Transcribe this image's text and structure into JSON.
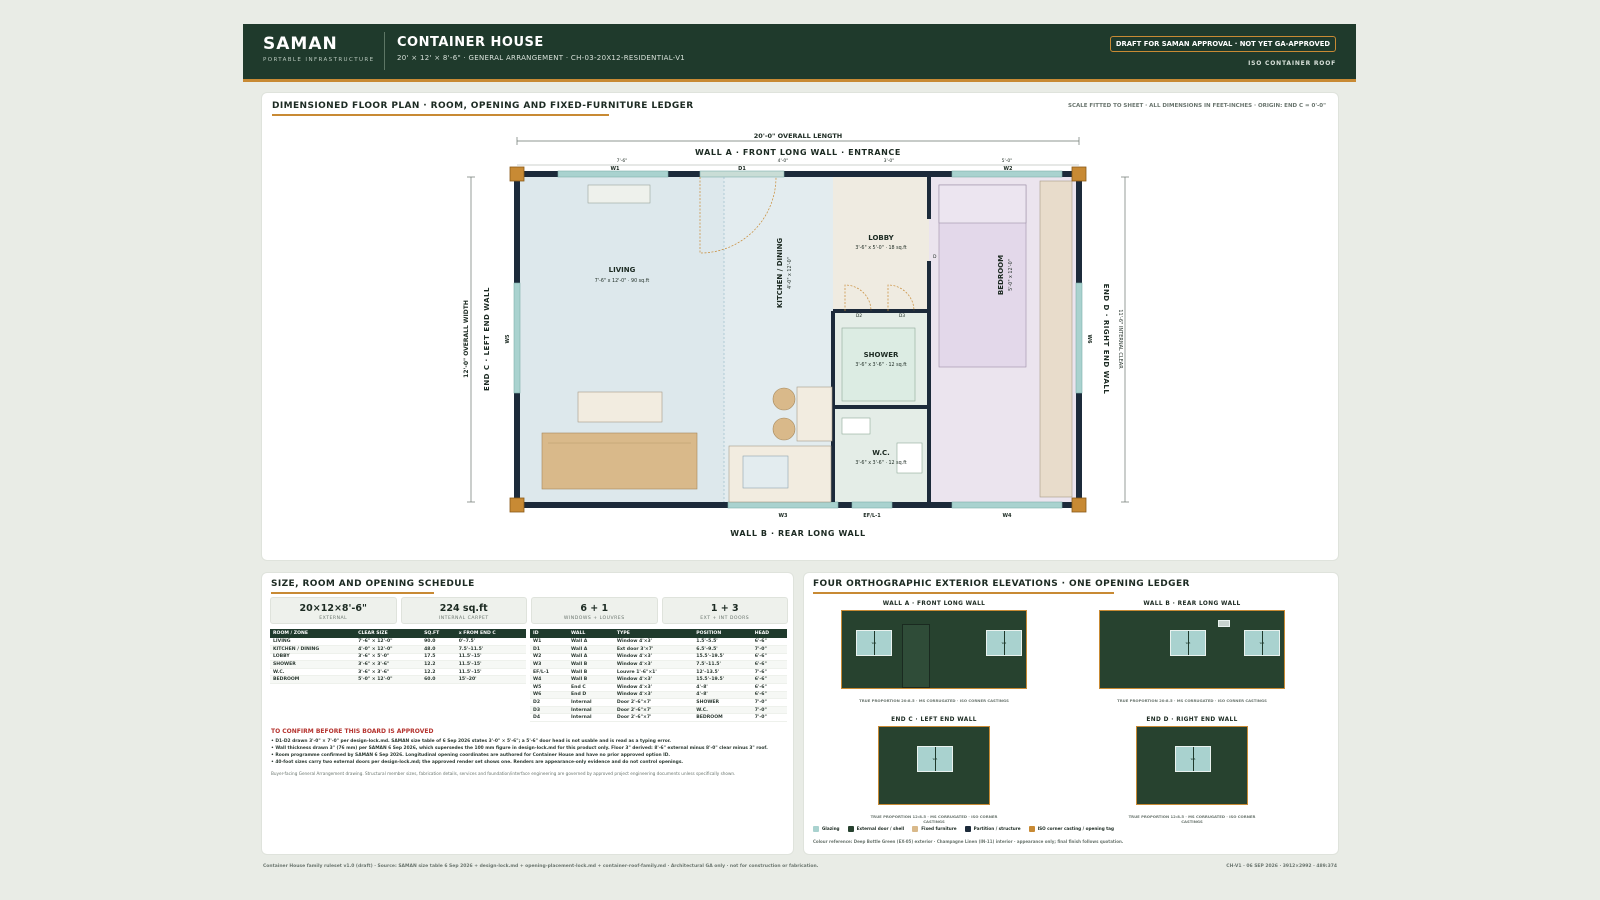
{
  "header": {
    "brand": "SAMAN",
    "brand_sub": "PORTABLE INFRASTRUCTURE",
    "title": "CONTAINER HOUSE",
    "subtitle": "20' × 12' × 8'-6\" · GENERAL ARRANGEMENT · CH-03-20X12-RESIDENTIAL-V1",
    "badge": "DRAFT FOR SAMAN APPROVAL · NOT YET GA-APPROVED",
    "roof": "ISO CONTAINER ROOF"
  },
  "plan": {
    "title": "DIMENSIONED FLOOR PLAN · ROOM, OPENING AND FIXED-FURNITURE LEDGER",
    "scale_note": "SCALE FITTED TO SHEET · ALL DIMENSIONS IN FEET-INCHES · ORIGIN: END C = 0'-0\"",
    "overall_length": "20'-0\" OVERALL LENGTH",
    "overall_width": "12'-0\" OVERALL WIDTH",
    "internal_clear": "11'-6\" INTERNAL CLEAR",
    "wall_a": "WALL A · FRONT LONG WALL · ENTRANCE",
    "wall_b": "WALL B · REAR LONG WALL",
    "end_c": "END C · LEFT END WALL",
    "end_d": "END D · RIGHT END WALL",
    "seg_dims": [
      "7'-6\"",
      "4'-0\"",
      "3'-0\"",
      "5'-0\""
    ],
    "rooms": {
      "living": {
        "name": "LIVING",
        "size": "7'-6\" x 12'-0\" · 90 sq.ft"
      },
      "kitchen": {
        "name": "KITCHEN / DINING",
        "size": "4'-0\" x 12'-0\""
      },
      "lobby": {
        "name": "LOBBY",
        "size": "3'-6\" x 5'-0\" · 18 sq.ft"
      },
      "shower": {
        "name": "SHOWER",
        "size": "3'-6\" x 3'-6\" · 12 sq.ft"
      },
      "wc": {
        "name": "W.C.",
        "size": "3'-6\" x 3'-6\" · 12 sq.ft"
      },
      "bedroom": {
        "name": "BEDROOM",
        "size": "5'-0\" x 12'-0\""
      }
    },
    "openings": {
      "w1": "W1",
      "d1": "D1",
      "w2": "W2",
      "w3": "W3",
      "efl1": "EF/L-1",
      "w4": "W4",
      "w5": "W5",
      "w6": "W6",
      "d2": "D2",
      "d3": "D3",
      "d4": "D"
    }
  },
  "schedule": {
    "title": "SIZE, ROOM AND OPENING SCHEDULE",
    "cards": [
      {
        "value": "20×12×8'-6\"",
        "label": "EXTERNAL"
      },
      {
        "value": "224 sq.ft",
        "label": "INTERNAL CARPET"
      },
      {
        "value": "6 + 1",
        "label": "WINDOWS + LOUVRES"
      },
      {
        "value": "1 + 3",
        "label": "EXT + INT DOORS"
      }
    ],
    "room_headers": [
      "ROOM / ZONE",
      "CLEAR SIZE",
      "SQ.FT",
      "x FROM END C"
    ],
    "rooms": [
      [
        "LIVING",
        "7'-6\" × 12'-0\"",
        "90.0",
        "0'–7.5'"
      ],
      [
        "KITCHEN / DINING",
        "4'-0\" × 12'-0\"",
        "48.0",
        "7.5'–11.5'"
      ],
      [
        "LOBBY",
        "3'-6\" × 5'-0\"",
        "17.5",
        "11.5'–15'"
      ],
      [
        "SHOWER",
        "3'-6\" × 3'-6\"",
        "12.2",
        "11.5'–15'"
      ],
      [
        "W.C.",
        "3'-6\" × 3'-6\"",
        "12.2",
        "11.5'–15'"
      ],
      [
        "BEDROOM",
        "5'-0\" × 12'-0\"",
        "60.0",
        "15'–20'"
      ]
    ],
    "opening_headers": [
      "ID",
      "WALL",
      "TYPE",
      "POSITION",
      "HEAD"
    ],
    "openings": [
      [
        "W1",
        "Wall A",
        "Window 4'×3'",
        "1.5'–5.5'",
        "6'-6\""
      ],
      [
        "D1",
        "Wall A",
        "Ext door 3'×7'",
        "6.5'–9.5'",
        "7'-0\""
      ],
      [
        "W2",
        "Wall A",
        "Window 4'×3'",
        "15.5'–19.5'",
        "6'-6\""
      ],
      [
        "W3",
        "Wall B",
        "Window 4'×3'",
        "7.5'–11.5'",
        "6'-6\""
      ],
      [
        "EF/L-1",
        "Wall B",
        "Louvre 1'-6\"×1'",
        "12'–13.5'",
        "7'-6\""
      ],
      [
        "W4",
        "Wall B",
        "Window 4'×3'",
        "15.5'–19.5'",
        "6'-6\""
      ],
      [
        "W5",
        "End C",
        "Window 4'×3'",
        "4'–8'",
        "6'-6\""
      ],
      [
        "W6",
        "End D",
        "Window 4'×3'",
        "4'–8'",
        "6'-6\""
      ],
      [
        "D2",
        "Internal",
        "Door 2'-6\"×7'",
        "SHOWER",
        "7'-0\""
      ],
      [
        "D3",
        "Internal",
        "Door 2'-6\"×7'",
        "W.C.",
        "7'-0\""
      ],
      [
        "D4",
        "Internal",
        "Door 2'-6\"×7'",
        "BEDROOM",
        "7'-0\""
      ]
    ],
    "notes_title": "TO CONFIRM BEFORE THIS BOARD IS APPROVED",
    "notes": [
      "• D1-D2 drawn 3'-0\" × 7'-0\" per design-lock.md. SAMAN size table of 6 Sep 2026 states 3'-0\" × 5'-6\"; a 5'-6\" door head is not usable and is read as a typing error.",
      "• Wall thickness drawn 3\" (76 mm) per SAMAN 6 Sep 2026, which supersedes the 100 mm figure in design-lock.md for this product only. Floor 3\" derived: 8'-6\" external minus 8'-0\" clear minus 3\" roof.",
      "• Room programme confirmed by SAMAN 6 Sep 2026. Longitudinal opening coordinates are authored for Container House and have no prior approved option ID.",
      "• 40-foot sizes carry two external doors per design-lock.md; the approved render set shows one. Renders are appearance-only evidence and do not control openings."
    ],
    "fine": "Buyer-facing General Arrangement drawing. Structural member sizes, fabrication details, services and foundation/interface engineering are governed by approved project engineering documents unless specifically shown."
  },
  "elevations": {
    "title": "FOUR ORTHOGRAPHIC EXTERIOR ELEVATIONS · ONE OPENING LEDGER",
    "a": {
      "title": "WALL A · FRONT LONG WALL",
      "caption": "TRUE PROPORTION 20:8.5 · MS CORRUGATED · ISO CORNER CASTINGS",
      "w1": "W1",
      "w2": "W2"
    },
    "b": {
      "title": "WALL B · REAR LONG WALL",
      "caption": "TRUE PROPORTION 20:8.5 · MS CORRUGATED · ISO CORNER CASTINGS",
      "w3": "W3",
      "w4": "W4"
    },
    "c": {
      "title": "END C · LEFT END WALL",
      "caption": "TRUE PROPORTION 12:8.5 · MS CORRUGATED · ISO CORNER CASTINGS",
      "w5": "W5"
    },
    "d": {
      "title": "END D · RIGHT END WALL",
      "caption": "TRUE PROPORTION 12:8.5 · MS CORRUGATED · ISO CORNER CASTINGS",
      "w6": "W6"
    },
    "legend": [
      {
        "label": "Glazing",
        "color": "#a9d2cf"
      },
      {
        "label": "External door / shell",
        "color": "#27422f"
      },
      {
        "label": "Fixed furniture",
        "color": "#d9b98a"
      },
      {
        "label": "Partition / structure",
        "color": "#1c2a3a"
      },
      {
        "label": "ISO corner casting / opening tag",
        "color": "#c88a34"
      }
    ],
    "colour_ref": "Colour reference: Deep Bottle Green (EX-05) exterior · Champagne Linen (IN-11) interior · appearance only; final finish follows quotation."
  },
  "footer": {
    "left": "Container House family ruleset v1.0 (draft) · Source: SAMAN size table 6 Sep 2026 + design-lock.md + opening-placement-lock.md + container-roof-family.md · Architectural GA only · not for construction or fabrication.",
    "right": "CH-V1 · 06 SEP 2026 · 3912×2992 · 489:374"
  }
}
